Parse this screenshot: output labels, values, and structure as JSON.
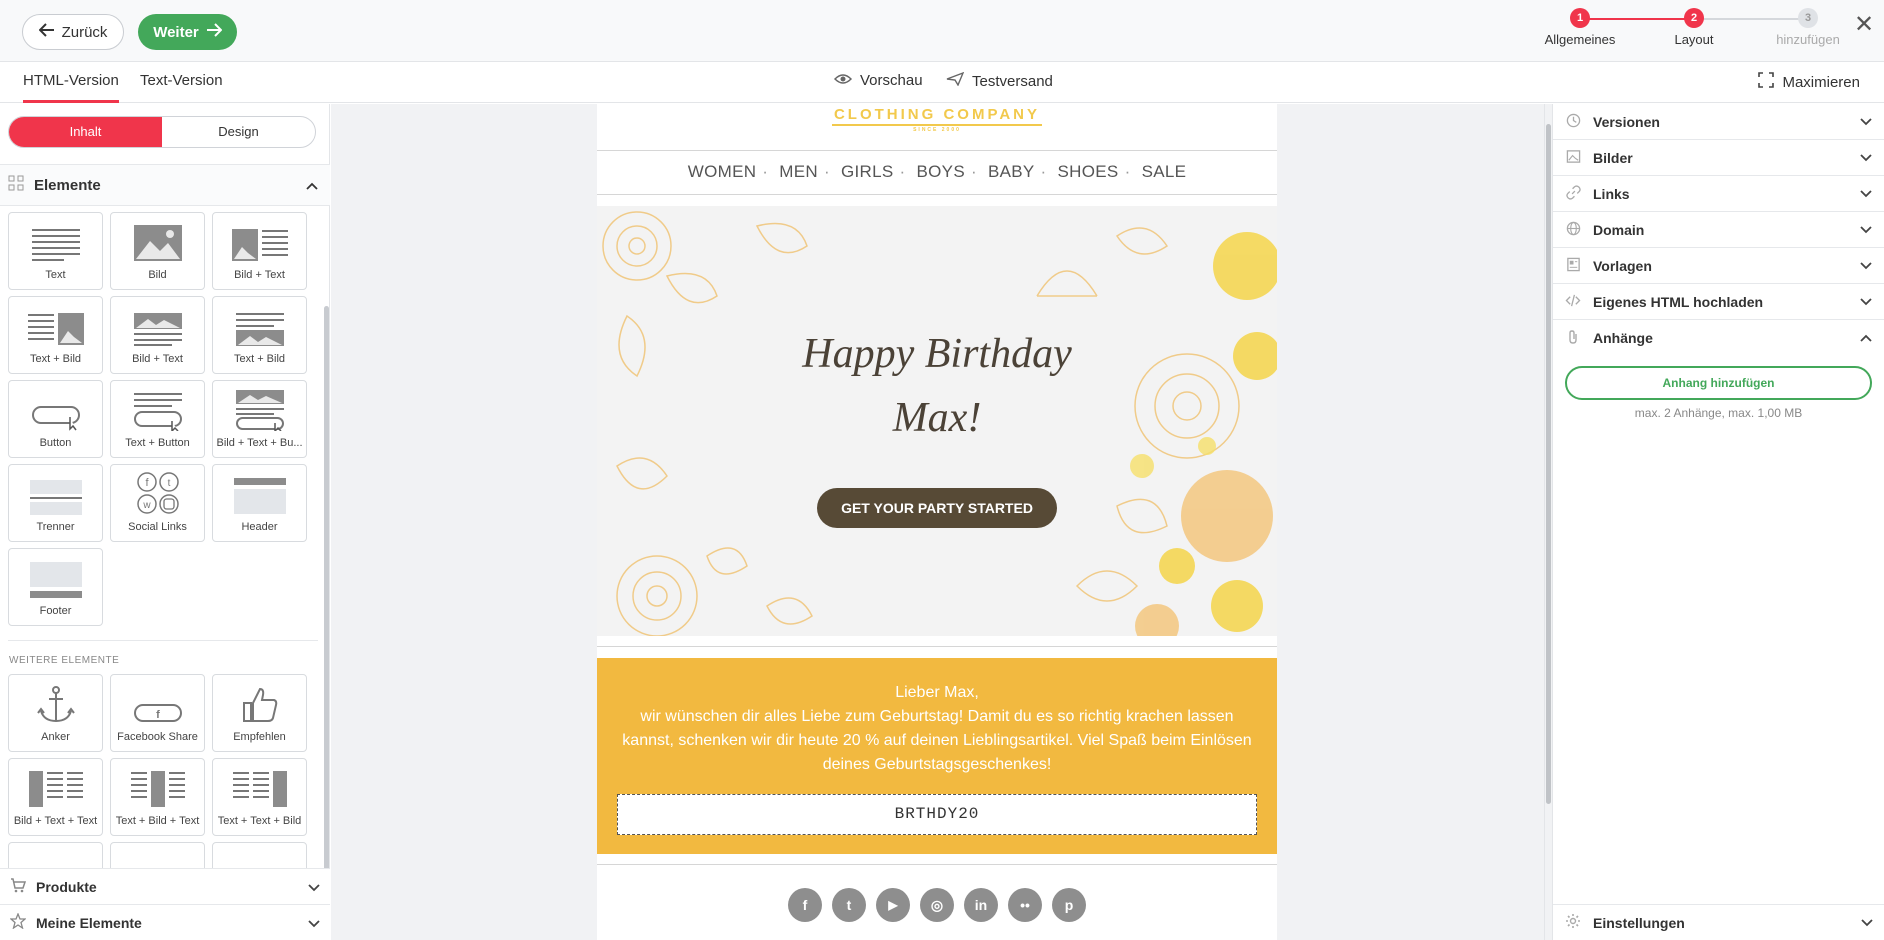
{
  "topbar": {
    "back_label": "Zurück",
    "next_label": "Weiter",
    "steps": [
      {
        "number": "1",
        "label": "Allgemeines",
        "state": "done"
      },
      {
        "number": "2",
        "label": "Layout",
        "state": "active"
      },
      {
        "number": "3",
        "label": "hinzufügen",
        "state": "pending"
      }
    ],
    "close_icon": "close-icon"
  },
  "tabs": {
    "html_version": "HTML-Version",
    "text_version": "Text-Version",
    "preview": "Vorschau",
    "test_send": "Testversand",
    "maximize": "Maximieren"
  },
  "sidebar": {
    "segment": {
      "content": "Inhalt",
      "design": "Design"
    },
    "elements_title": "Elemente",
    "elements": [
      {
        "label": "Text",
        "icon": "text-block-icon"
      },
      {
        "label": "Bild",
        "icon": "image-block-icon"
      },
      {
        "label": "Bild + Text",
        "icon": "image-text-block-icon"
      },
      {
        "label": "Text + Bild",
        "icon": "text-image-block-icon"
      },
      {
        "label": "Bild + Text",
        "icon": "image-over-text-block-icon"
      },
      {
        "label": "Text + Bild",
        "icon": "text-over-image-block-icon"
      },
      {
        "label": "Button",
        "icon": "button-block-icon"
      },
      {
        "label": "Text + Button",
        "icon": "text-button-block-icon"
      },
      {
        "label": "Bild + Text + Bu...",
        "icon": "image-text-button-block-icon"
      },
      {
        "label": "Trenner",
        "icon": "divider-block-icon"
      },
      {
        "label": "Social Links",
        "icon": "social-links-block-icon"
      },
      {
        "label": "Header",
        "icon": "header-block-icon"
      },
      {
        "label": "Footer",
        "icon": "footer-block-icon"
      }
    ],
    "more_title": "WEITERE ELEMENTE",
    "more_elements": [
      {
        "label": "Anker",
        "icon": "anchor-icon"
      },
      {
        "label": "Facebook Share",
        "icon": "facebook-share-icon"
      },
      {
        "label": "Empfehlen",
        "icon": "thumbs-up-icon"
      },
      {
        "label": "Bild + Text + Text",
        "icon": "image-text-text-block-icon"
      },
      {
        "label": "Text + Bild + Text",
        "icon": "text-image-text-block-icon"
      },
      {
        "label": "Text + Text + Bild",
        "icon": "text-text-image-block-icon"
      }
    ],
    "products_label": "Produkte",
    "my_elements_label": "Meine Elemente"
  },
  "email": {
    "logo_text": "CLOTHING COMPANY",
    "logo_since": "SINCE 2000",
    "nav": [
      "WOMEN",
      "MEN",
      "GIRLS",
      "BOYS",
      "BABY",
      "SHOES",
      "SALE"
    ],
    "hero_line1": "Happy Birthday",
    "hero_line2": "Max!",
    "hero_button": "GET YOUR PARTY STARTED",
    "greeting": "Lieber Max,",
    "body_text": "wir wünschen dir alles Liebe zum Geburtstag! Damit du es so richtig krachen lassen kannst, schenken wir dir heute 20 % auf deinen Lieblingsartikel. Viel Spaß beim Einlösen deines Geburtstagsgeschenkes!",
    "coupon_code": "BRTHDY20",
    "social": [
      {
        "icon": "facebook-icon",
        "glyph": "f"
      },
      {
        "icon": "twitter-icon",
        "glyph": "t"
      },
      {
        "icon": "youtube-icon",
        "glyph": "▶"
      },
      {
        "icon": "instagram-icon",
        "glyph": "◎"
      },
      {
        "icon": "linkedin-icon",
        "glyph": "in"
      },
      {
        "icon": "flickr-icon",
        "glyph": "••"
      },
      {
        "icon": "pinterest-icon",
        "glyph": "p"
      }
    ],
    "colors": {
      "accent_yellow": "#f2b940",
      "hero_button": "#574a36",
      "logo": "#f2c94c"
    }
  },
  "right_panel": {
    "items": [
      {
        "label": "Versionen",
        "icon": "clock-icon"
      },
      {
        "label": "Bilder",
        "icon": "image-icon"
      },
      {
        "label": "Links",
        "icon": "link-icon"
      },
      {
        "label": "Domain",
        "icon": "globe-icon"
      },
      {
        "label": "Vorlagen",
        "icon": "template-icon"
      },
      {
        "label": "Eigenes HTML hochladen",
        "icon": "code-icon"
      }
    ],
    "attachments_label": "Anhänge",
    "add_attachment": "Anhang hinzufügen",
    "attachment_info": "max. 2 Anhänge, max. 1,00 MB",
    "settings_label": "Einstellungen"
  },
  "colors": {
    "primary_red": "#f0354b",
    "green": "#43a85a"
  }
}
